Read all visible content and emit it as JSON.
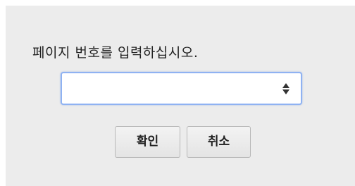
{
  "dialog": {
    "prompt": "페이지 번호를 입력하십시오.",
    "page_number_value": "",
    "page_number_placeholder": "",
    "ok_label": "확인",
    "cancel_label": "취소"
  },
  "icons": {
    "spinner": "up-down-spinner-icon"
  },
  "colors": {
    "dialog_background": "#ececec",
    "input_focus_border": "#8fb2f2"
  }
}
